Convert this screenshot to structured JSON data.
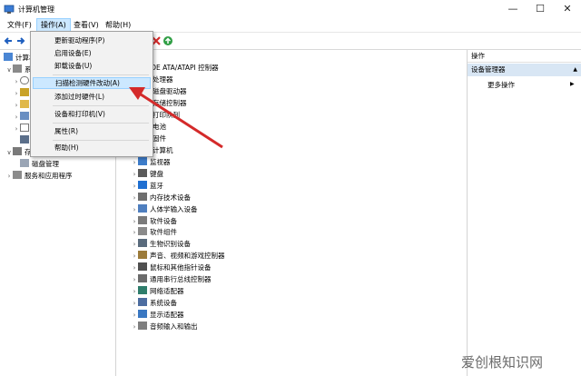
{
  "window": {
    "title": "计算机管理",
    "minimize": "—",
    "maximize": "☐",
    "close": "✕"
  },
  "menubar": {
    "items": [
      "文件(F)",
      "操作(A)",
      "查看(V)",
      "帮助(H)"
    ]
  },
  "left_tree": {
    "root": "计算机",
    "r1": "系",
    "r2": "存",
    "disk": "磁盘管理",
    "services": "服务和应用程序"
  },
  "context_menu": {
    "items": [
      "更新驱动程序(P)",
      "启用设备(E)",
      "卸载设备(U)",
      "扫描检测硬件改动(A)",
      "添加过时硬件(L)",
      "设备和打印机(V)",
      "属性(R)",
      "帮助(H)"
    ],
    "highlighted": "扫描检测硬件改动(A)"
  },
  "device_tree": {
    "partial": [
      "IDE ATA/ATAPI 控制器",
      "处理器",
      "磁盘驱动器",
      "存储控制器",
      "打印队列",
      "电池",
      "固件",
      "计算机"
    ],
    "items": [
      "监视器",
      "键盘",
      "蓝牙",
      "内存技术设备",
      "人体学输入设备",
      "软件设备",
      "软件组件",
      "生物识别设备",
      "声音、视频和游戏控制器",
      "鼠标和其他指针设备",
      "通用串行总线控制器",
      "网络适配器",
      "系统设备",
      "显示适配器",
      "音频输入和输出"
    ]
  },
  "actions_pane": {
    "header": "操作",
    "section": "设备管理器",
    "more": "更多操作",
    "section_arrow": "▲",
    "more_arrow": "▶"
  },
  "watermark": "爱创根知识网",
  "colors": {
    "highlight": "#cce8ff",
    "section": "#d8e6f4",
    "arrow": "#d42a2a"
  }
}
